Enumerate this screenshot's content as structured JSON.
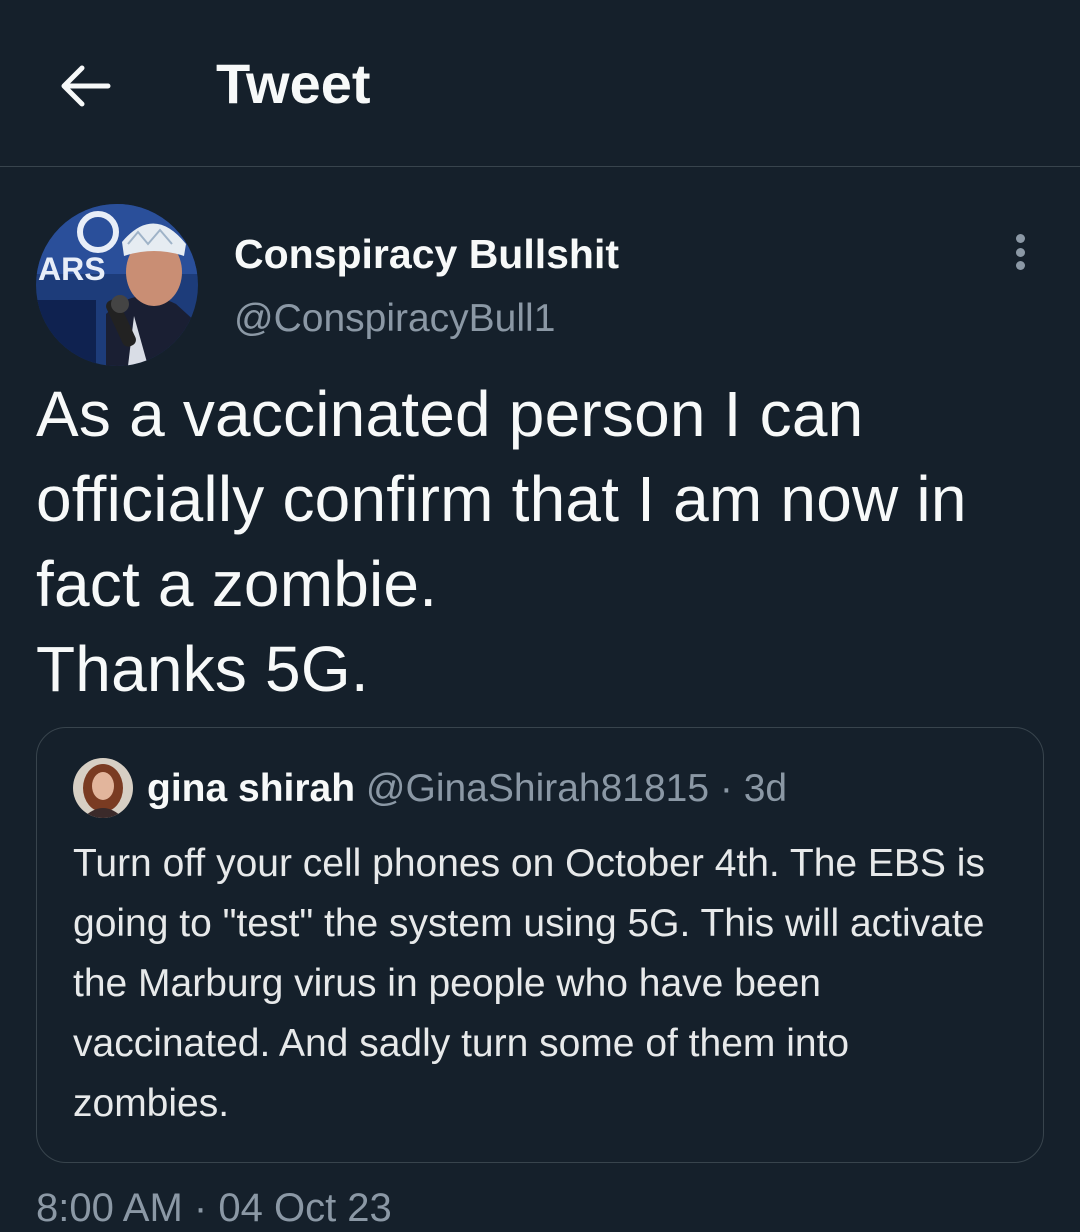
{
  "header": {
    "back_icon": "arrow-left-icon",
    "title": "Tweet"
  },
  "tweet": {
    "author": {
      "display_name": "Conspiracy Bullshit",
      "handle": "@ConspiracyBull1",
      "avatar_text": "ARS"
    },
    "more_icon": "more-vertical-icon",
    "text": "As a vaccinated person I can officially confirm that I am now in fact a zombie.\nThanks 5G.",
    "timestamp": {
      "time": "8:00 AM",
      "separator": "·",
      "date": "04 Oct 23"
    }
  },
  "quoted_tweet": {
    "display_name": "gina shirah",
    "handle": "@GinaShirah81815",
    "separator": "·",
    "time_ago": "3d",
    "text": "Turn off your cell phones on October 4th. The EBS is going to \"test\" the system using 5G. This will activate the Marburg virus in people who have been vaccinated. And sadly turn some of them into zombies."
  },
  "colors": {
    "background": "#15202b",
    "text_primary": "#f7f9f9",
    "text_secondary": "#8b98a5",
    "border": "#38444d"
  }
}
